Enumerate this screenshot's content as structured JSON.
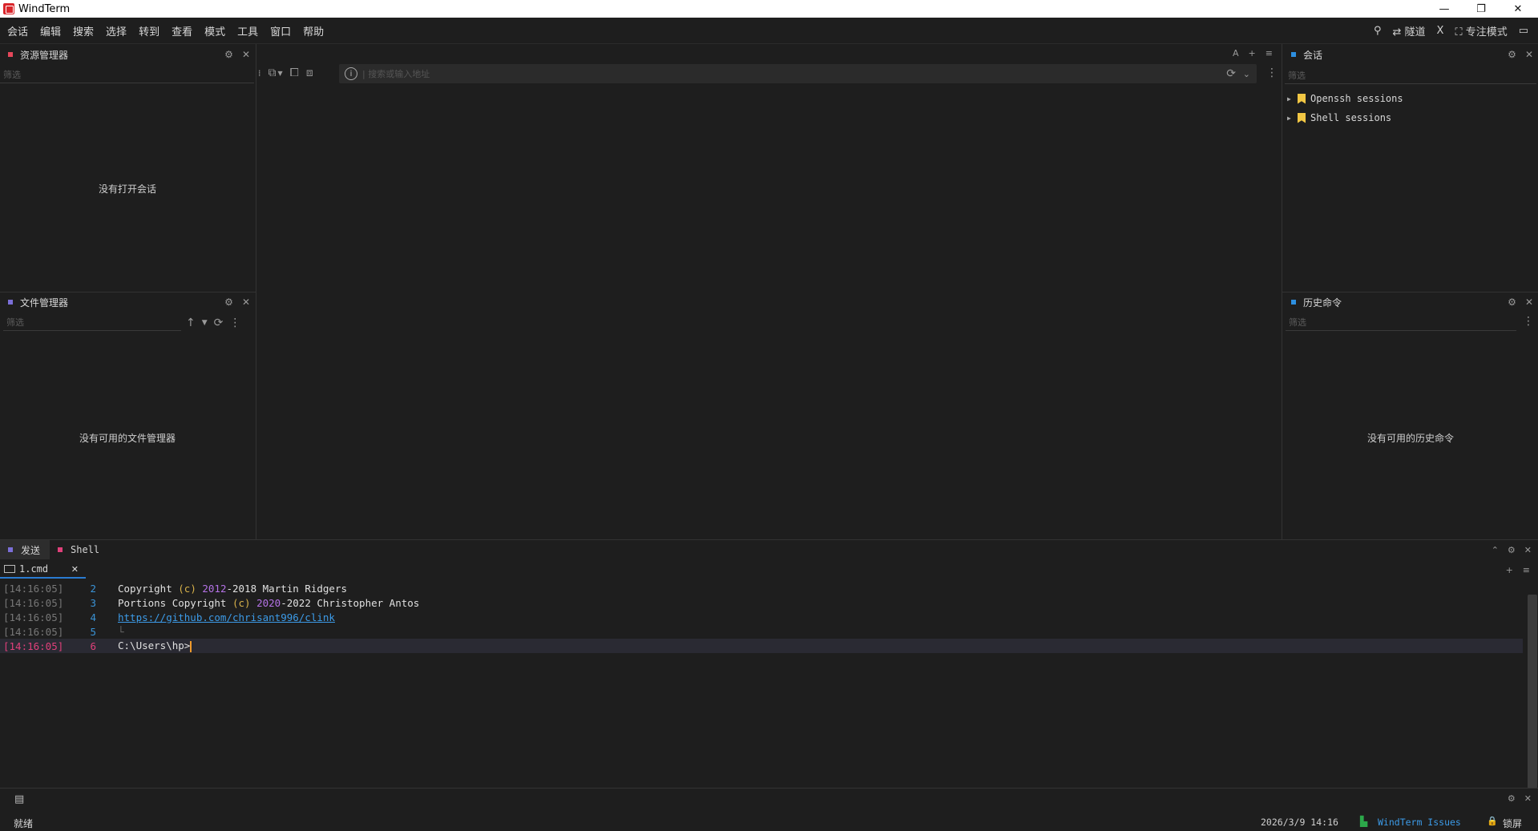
{
  "window": {
    "title": "WindTerm",
    "controls": {
      "minimize": "—",
      "restore": "❐",
      "close": "✕"
    }
  },
  "menu": {
    "items": [
      "会话",
      "编辑",
      "搜索",
      "选择",
      "转到",
      "查看",
      "模式",
      "工具",
      "窗口",
      "帮助"
    ],
    "right": {
      "tunnel": "隧道",
      "x": "X",
      "focus_mode": "专注模式"
    }
  },
  "resource_manager": {
    "title": "资源管理器",
    "filter_placeholder": "筛选",
    "empty": "没有打开会话"
  },
  "file_manager": {
    "title": "文件管理器",
    "filter_placeholder": "筛选",
    "empty": "没有可用的文件管理器"
  },
  "center": {
    "address_placeholder": "| 搜索或输入地址",
    "top_right_a": "A"
  },
  "sessions": {
    "title": "会话",
    "filter_placeholder": "筛选",
    "items": [
      "Openssh sessions",
      "Shell sessions"
    ]
  },
  "history": {
    "title": "历史命令",
    "filter_placeholder": "筛选",
    "empty": "没有可用的历史命令"
  },
  "bottom": {
    "tabs": [
      "发送",
      "Shell"
    ],
    "doc_tab": "1.cmd"
  },
  "terminal": {
    "lines": [
      {
        "ts": "[14:16:05]",
        "ln": "2",
        "parts": [
          "Copyright ",
          "(c)",
          " ",
          "2012",
          "-2018 Martin Ridgers"
        ]
      },
      {
        "ts": "[14:16:05]",
        "ln": "3",
        "parts": [
          "Portions Copyright ",
          "(c)",
          " ",
          "2020",
          "-2022 Christopher Antos"
        ]
      },
      {
        "ts": "[14:16:05]",
        "ln": "4",
        "link": "https://github.com/chrisant996/clink"
      },
      {
        "ts": "[14:16:05]",
        "ln": "5"
      },
      {
        "ts": "[14:16:05]",
        "ln": "6",
        "prompt": "C:\\Users\\hp>"
      }
    ]
  },
  "status": {
    "ready": "就绪",
    "datetime": "2026/3/9 14:16",
    "issues": "WindTerm Issues",
    "lock": "锁屏"
  },
  "colors": {
    "accent_blue": "#2a7bd1",
    "pink": "#e0407a",
    "yellow": "#d8b24a",
    "purple": "#b472e6",
    "red_dot": "#e5475a",
    "violet_dot": "#7b6fd8",
    "blue_dot": "#2d8fe0"
  }
}
